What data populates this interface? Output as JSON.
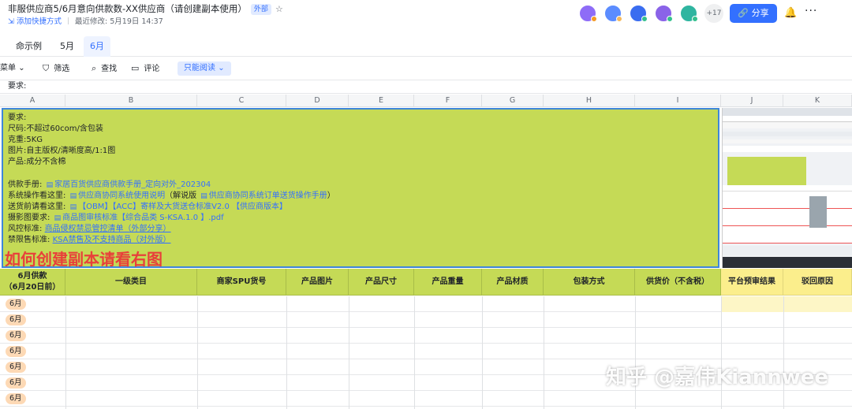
{
  "header": {
    "title": "非服供应商5/6月意向供款数-XX供应商（请创建副本使用）",
    "badge": "外部",
    "add_shortcut": "添加快捷方式",
    "last_modified": "最近修改: 5月19日 14:37",
    "avatar_more": "+17",
    "share_label": "分享",
    "avatar_colors": [
      "#7b61ff",
      "#4f7dff",
      "#3370ff",
      "#8d6bf5",
      "#2fb5a0"
    ]
  },
  "tabs": [
    {
      "label": "命示例"
    },
    {
      "label": "5月"
    },
    {
      "label": "6月",
      "active": true
    }
  ],
  "toolbar": {
    "menu": "菜单",
    "filter": "筛选",
    "find": "查找",
    "comment": "评论",
    "mode": "只能阅读"
  },
  "formula_bar": "要求:",
  "columns": [
    "A",
    "B",
    "C",
    "D",
    "E",
    "F",
    "G",
    "H",
    "I",
    "J",
    "K"
  ],
  "notes": {
    "l1": "要求:",
    "l2_label": "尺码:",
    "l2_value": "不超过60com/含包装",
    "l3_label": "克重:",
    "l3_value": "5KG",
    "l4_label": "图片:",
    "l4_value": "自主版权/清晰度高/1:1图",
    "l5_label": "产品:",
    "l5_value": "成分不含棉",
    "l6_label": "供款手册:",
    "l6_link": "家居百货供应商供款手册_定向对外_202304",
    "l7_label": "系统操作看这里:",
    "l7_link1": "供应商协同系统使用说明",
    "l7_text": "（解说版",
    "l7_link2": "供应商协同系统订单送货操作手册",
    "l7_tail": "）",
    "l8_label": "送货前请看这里:",
    "l8_link": "【OBM】【ACC】寄样及大货送仓标准V2.0 【供应商版本】",
    "l9_label": "摄影图要求:",
    "l9_link": "商品图审核标准【综合品类 S-KSA.1.0 】.pdf",
    "l10_label": "风控标准:",
    "l10_link": "商品侵权禁忌管控清单（外部分享）",
    "l11_label": "禁限售标准:",
    "l11_link": "KSA禁售及不支持商品（对外版）",
    "big": "如何创建副本请看右图"
  },
  "table_header": [
    "6月供款\n（6月20日前）",
    "一级类目",
    "商家SPU货号",
    "产品图片",
    "产品尺寸",
    "产品重量",
    "产品材质",
    "包装方式",
    "供货价（不含税）",
    "平台预审结果",
    "驳回原因"
  ],
  "rows": [
    "6月",
    "6月",
    "6月",
    "6月",
    "6月",
    "6月",
    "6月"
  ],
  "watermark": "知乎 @嘉伟Kiannwee"
}
